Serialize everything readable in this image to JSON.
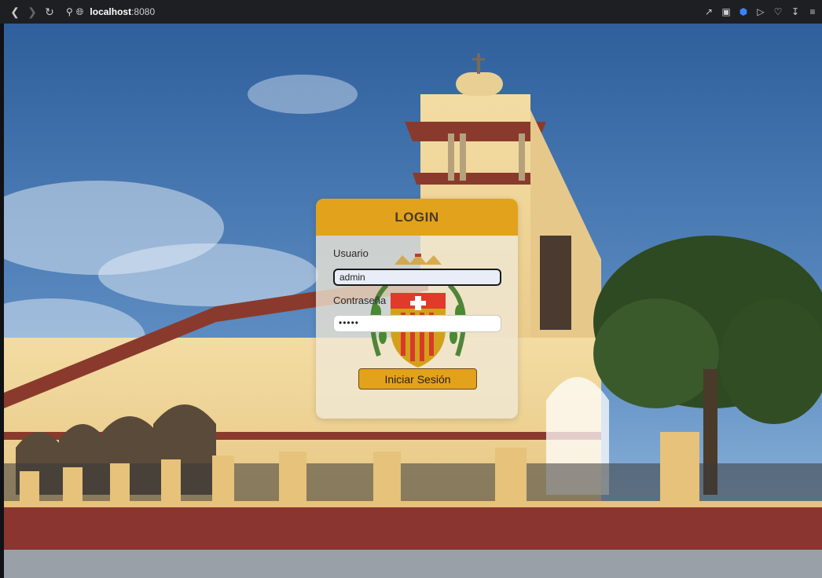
{
  "browser": {
    "back_icon": "back-arrow-icon",
    "forward_icon": "forward-arrow-icon",
    "reload_icon": "reload-icon",
    "url_host": "localhost",
    "url_port": ":8080"
  },
  "login": {
    "title": "LOGIN",
    "user_label": "Usuario",
    "user_value": "admin",
    "password_label": "Contraseña",
    "password_value": "•••••",
    "submit_label": "Iniciar Sesión"
  },
  "colors": {
    "accent": "#e2a21c",
    "sky": "#3f6fa8",
    "church_wall": "#f0d596",
    "trim": "#8a3a2c"
  }
}
